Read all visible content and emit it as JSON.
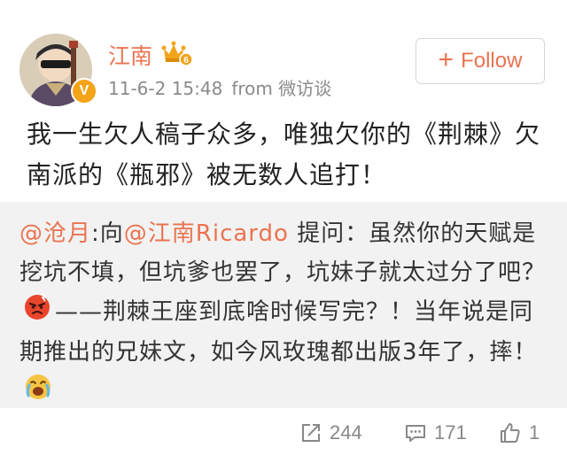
{
  "user": {
    "name": "江南",
    "verified_badge": "V",
    "timestamp": "11-6-2 15:48",
    "source": "from 微访谈"
  },
  "follow_button": {
    "icon": "plus-icon",
    "label": "Follow"
  },
  "post": {
    "text": "我一生欠人稿子众多，唯独欠你的《荆棘》欠南派的《瓶邪》被无数人追打！"
  },
  "repost": {
    "mention_author": "@沧月",
    "colon_to": ":向",
    "mention_target": "@江南Ricardo",
    "text_part1": " 提问：虽然你的天赋是挖坑不填，但坑爹也罢了，坑妹子就太过分了吧？",
    "emoji1": "angry-face-icon",
    "text_part2": "——荆棘王座到底啥时候写完？！当年说是同期推出的兄妹文，如今风玫瑰都出版3年了，摔！",
    "emoji2": "crying-face-icon"
  },
  "actions": {
    "repost_count": "244",
    "comment_count": "171",
    "like_count": "1"
  },
  "colors": {
    "accent": "#eb7350",
    "meta_gray": "#8a8a8a",
    "repost_bg": "#f2f2f2"
  }
}
